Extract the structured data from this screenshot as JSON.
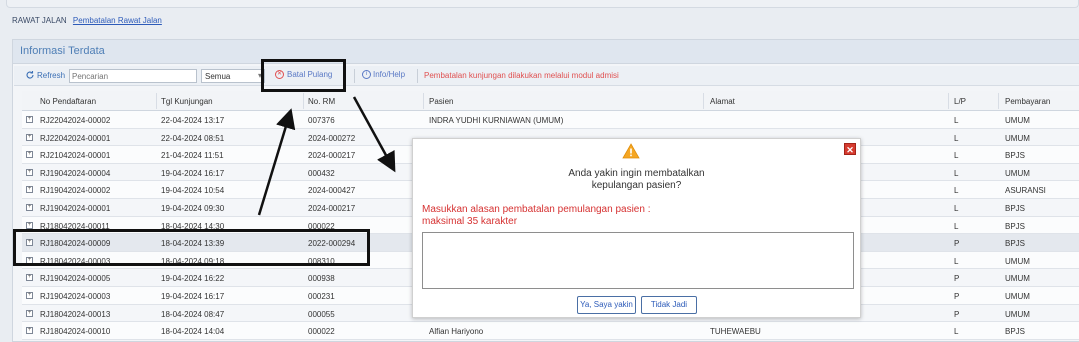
{
  "breadcrumb": {
    "root": "RAWAT JALAN",
    "current": "Pembatalan Rawat Jalan"
  },
  "panel": {
    "title": "Informasi Terdata"
  },
  "toolbar": {
    "refresh_label": "Refresh",
    "search_placeholder": "Pencarian",
    "filter_value": "Semua",
    "batal_label": "Batal Pulang",
    "info_label": "Info/Help",
    "note": "Pembatalan kunjungan dilakukan melalui modul admisi"
  },
  "columns": {
    "no_pendaftaran": "No Pendaftaran",
    "tgl_kunjungan": "Tgl Kunjungan",
    "no_rm": "No. RM",
    "pasien": "Pasien",
    "alamat": "Alamat",
    "lp": "L/P",
    "pembayaran": "Pembayaran"
  },
  "rows": [
    {
      "no": "RJ22042024-00002",
      "tgl": "22-04-2024 13:17",
      "rm": "007376",
      "pasien": "INDRA YUDHI KURNIAWAN (UMUM)",
      "alamat": "",
      "lp": "L",
      "bayar": "UMUM"
    },
    {
      "no": "RJ22042024-00001",
      "tgl": "22-04-2024 08:51",
      "rm": "2024-000272",
      "pasien": "",
      "alamat": "",
      "lp": "L",
      "bayar": "UMUM"
    },
    {
      "no": "RJ21042024-00001",
      "tgl": "21-04-2024 11:51",
      "rm": "2024-000217",
      "pasien": "",
      "alamat": "",
      "lp": "L",
      "bayar": "BPJS"
    },
    {
      "no": "RJ19042024-00004",
      "tgl": "19-04-2024 16:17",
      "rm": "000432",
      "pasien": "",
      "alamat": "",
      "lp": "L",
      "bayar": "UMUM"
    },
    {
      "no": "RJ19042024-00002",
      "tgl": "19-04-2024 10:54",
      "rm": "2024-000427",
      "pasien": "",
      "alamat": "",
      "lp": "L",
      "bayar": "ASURANSI"
    },
    {
      "no": "RJ19042024-00001",
      "tgl": "19-04-2024 09:30",
      "rm": "2024-000217",
      "pasien": "",
      "alamat": "",
      "lp": "L",
      "bayar": "BPJS"
    },
    {
      "no": "RJ18042024-00011",
      "tgl": "18-04-2024 14:30",
      "rm": "000022",
      "pasien": "",
      "alamat": "",
      "lp": "L",
      "bayar": "BPJS"
    },
    {
      "no": "RJ18042024-00009",
      "tgl": "18-04-2024 13:39",
      "rm": "2022-000294",
      "pasien": "",
      "alamat": "",
      "lp": "P",
      "bayar": "BPJS"
    },
    {
      "no": "RJ18042024-00003",
      "tgl": "18-04-2024 09:18",
      "rm": "008310",
      "pasien": "",
      "alamat": "",
      "lp": "L",
      "bayar": "UMUM"
    },
    {
      "no": "RJ19042024-00005",
      "tgl": "19-04-2024 16:22",
      "rm": "000938",
      "pasien": "",
      "alamat": "",
      "lp": "P",
      "bayar": "UMUM"
    },
    {
      "no": "RJ19042024-00003",
      "tgl": "19-04-2024 16:17",
      "rm": "000231",
      "pasien": "",
      "alamat": "",
      "lp": "P",
      "bayar": "UMUM"
    },
    {
      "no": "RJ18042024-00013",
      "tgl": "18-04-2024 08:47",
      "rm": "000055",
      "pasien": "",
      "alamat": "",
      "lp": "P",
      "bayar": "UMUM"
    },
    {
      "no": "RJ18042024-00010",
      "tgl": "18-04-2024 14:04",
      "rm": "000022",
      "pasien": "Alfian Hariyono",
      "alamat": "TUHEWAEBU",
      "lp": "L",
      "bayar": "BPJS"
    }
  ],
  "dialog": {
    "question_line1": "Anda yakin ingin membatalkan",
    "question_line2": "kepulangan pasien?",
    "instruction_line1": "Masukkan alasan pembatalan pemulangan pasien :",
    "instruction_line2": "maksimal 35 karakter",
    "confirm_label": "Ya, Saya yakin",
    "cancel_label": "Tidak Jadi",
    "close_glyph": "✕"
  },
  "colors": {
    "accent": "#2d5bb9",
    "warning": "#f5a623",
    "danger": "#d63232"
  }
}
